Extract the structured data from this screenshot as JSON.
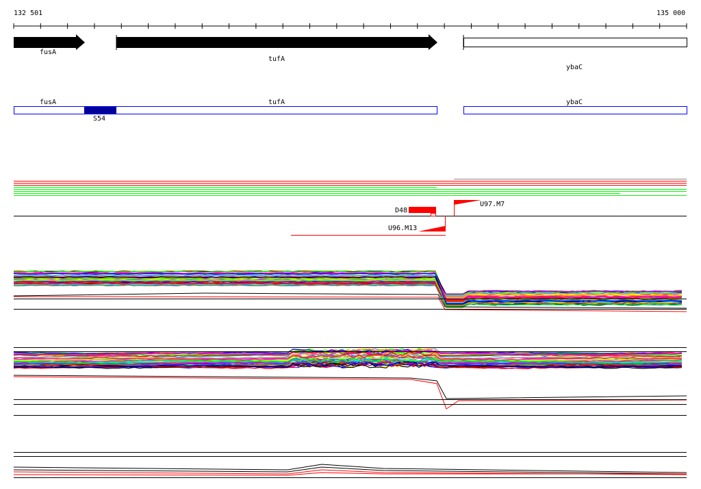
{
  "ruler": {
    "start_label": "132 501",
    "end_label": "135 000"
  },
  "genes_track": [
    {
      "name": "fusA"
    },
    {
      "name": "tufA"
    },
    {
      "name": "ybaC"
    }
  ],
  "annotation_track": {
    "genes": [
      {
        "name": "fusA"
      },
      {
        "name": "tufA"
      },
      {
        "name": "ybaC"
      }
    ],
    "feature": {
      "name": "S54",
      "color": "#000099"
    }
  },
  "markers": [
    {
      "name": "D48"
    },
    {
      "name": "U96.M13"
    },
    {
      "name": "U97.M7"
    }
  ],
  "colors": {
    "accent_red": "#ff0000",
    "accent_green": "#00ff00",
    "annotation_blue": "#0000ff",
    "profile_palette": [
      "#ff0000",
      "#00ff00",
      "#0000ff",
      "#ff00ff",
      "#00ffff",
      "#ffff00",
      "#ff8800",
      "#888888",
      "#8800ff",
      "#0088ff",
      "#000000",
      "#88ff00",
      "#ff0088",
      "#996633"
    ]
  }
}
